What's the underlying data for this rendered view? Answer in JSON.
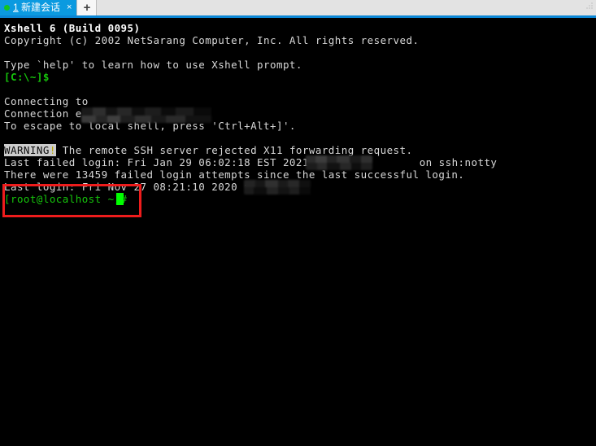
{
  "window": {
    "app": "Xshell",
    "background_color": "#000000",
    "accent_color": "#0b9ae0"
  },
  "tabbar": {
    "active_tab": {
      "accesskey": "1",
      "title": "新建会话",
      "status_dot": "connected-dot",
      "close_label": "×"
    },
    "new_tab_label": "+",
    "corner_icon": "resize-grip-icon"
  },
  "terminal": {
    "lines": [
      {
        "id": "banner-title",
        "text": "Xshell 6 (Build 0095)"
      },
      {
        "id": "banner-copyright",
        "text": "Copyright (c) 2002 NetSarang Computer, Inc. All rights reserved."
      },
      {
        "id": "banner-help",
        "text": "Type `help' to learn how to use Xshell prompt."
      },
      {
        "id": "local-prompt",
        "text": "[C:\\~]$"
      },
      {
        "id": "connecting",
        "text": "Connecting to "
      },
      {
        "id": "connection-established",
        "text": "Connection established."
      },
      {
        "id": "escape-hint",
        "text": "To escape to local shell, press 'Ctrl+Alt+]'."
      },
      {
        "id": "warning-tag",
        "text": "WARNING"
      },
      {
        "id": "warning-bang",
        "text": "!"
      },
      {
        "id": "warning-message",
        "text": " The remote SSH server rejected X11 forwarding request."
      },
      {
        "id": "last-failed-login-pre",
        "text": "Last failed login: Fri Jan 29 06:02:18 EST 2021 from "
      },
      {
        "id": "last-failed-login-post",
        "text": " on ssh:notty"
      },
      {
        "id": "failed-attempts",
        "text": "There were 13459 failed login attempts since the last successful login."
      },
      {
        "id": "last-login",
        "text": "Last login: Fri Nov 27 08:21:10 2020 from "
      },
      {
        "id": "shell-prompt",
        "text": "[root@localhost ~]#"
      }
    ],
    "redactions": [
      {
        "id": "redaction-connect-host",
        "label": "redacted-hostname"
      },
      {
        "id": "redaction-failed-login-ip",
        "label": "redacted-ip-address"
      },
      {
        "id": "redaction-last-login-ip",
        "label": "redacted-ip-address"
      }
    ],
    "cursor": {
      "id": "block-cursor",
      "color": "#00ff00"
    }
  },
  "annotation": {
    "id": "highlight-rectangle",
    "color": "#ee1c1c",
    "target": "shell-prompt"
  }
}
